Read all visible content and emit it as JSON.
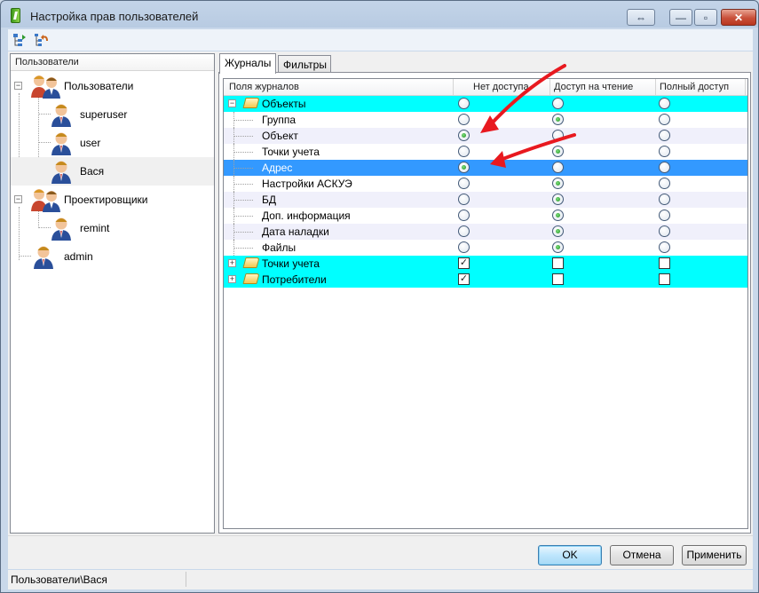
{
  "window": {
    "title": "Настройка прав пользователей",
    "buttons": [
      {
        "name": "restore",
        "glyph": "⇔"
      },
      {
        "name": "minimize",
        "glyph": "—"
      },
      {
        "name": "maximize",
        "glyph": "▫"
      },
      {
        "name": "close",
        "glyph": "✕"
      }
    ]
  },
  "toolbar": {
    "icons": [
      "apply-tree-icon",
      "undo-tree-icon"
    ]
  },
  "left_panel": {
    "header": "Пользователи",
    "tree": [
      {
        "label": "Пользователи",
        "type": "group",
        "expanded": true,
        "expander": "−"
      },
      {
        "label": "superuser",
        "type": "user"
      },
      {
        "label": "user",
        "type": "user"
      },
      {
        "label": "Вася",
        "type": "user",
        "selected": true
      },
      {
        "label": "Проектировщики",
        "type": "group",
        "expanded": true,
        "expander": "−"
      },
      {
        "label": "remint",
        "type": "user"
      },
      {
        "label": "admin",
        "type": "user"
      }
    ]
  },
  "tabs": [
    {
      "label": "Журналы",
      "active": true
    },
    {
      "label": "Фильтры",
      "active": false
    }
  ],
  "grid": {
    "columns": [
      "Поля журналов",
      "Нет доступа",
      "Доступ на чтение",
      "Полный доступ"
    ],
    "rows": [
      {
        "label": "Объекты",
        "level": 0,
        "kind": "folder",
        "expander": "−",
        "style": "cyan",
        "controls": "radio",
        "values": [
          false,
          false,
          false
        ]
      },
      {
        "label": "Группа",
        "level": 1,
        "style": "white",
        "controls": "radio",
        "values": [
          false,
          true,
          false
        ]
      },
      {
        "label": "Объект",
        "level": 1,
        "style": "alt",
        "controls": "radio",
        "values": [
          true,
          false,
          false
        ]
      },
      {
        "label": "Точки учета",
        "level": 1,
        "style": "white",
        "controls": "radio",
        "values": [
          false,
          true,
          false
        ]
      },
      {
        "label": "Адрес",
        "level": 1,
        "style": "sel",
        "controls": "radio",
        "values": [
          true,
          false,
          false
        ]
      },
      {
        "label": "Настройки АСКУЭ",
        "level": 1,
        "style": "white",
        "controls": "radio",
        "values": [
          false,
          true,
          false
        ]
      },
      {
        "label": "БД",
        "level": 1,
        "style": "alt",
        "controls": "radio",
        "values": [
          false,
          true,
          false
        ]
      },
      {
        "label": "Доп. информация",
        "level": 1,
        "style": "white",
        "controls": "radio",
        "values": [
          false,
          true,
          false
        ]
      },
      {
        "label": "Дата наладки",
        "level": 1,
        "style": "alt",
        "controls": "radio",
        "values": [
          false,
          true,
          false
        ]
      },
      {
        "label": "Файлы",
        "level": 1,
        "style": "white",
        "controls": "radio",
        "values": [
          false,
          true,
          false
        ]
      },
      {
        "label": "Точки учета",
        "level": 0,
        "kind": "folder",
        "expander": "+",
        "style": "cyan",
        "controls": "checkbox",
        "values": [
          true,
          false,
          false
        ]
      },
      {
        "label": "Потребители",
        "level": 0,
        "kind": "folder",
        "expander": "+",
        "style": "cyan",
        "controls": "checkbox",
        "values": [
          true,
          false,
          false
        ]
      }
    ]
  },
  "buttons": {
    "ok": "OK",
    "cancel": "Отмена",
    "apply": "Применить"
  },
  "status": {
    "path": "Пользователи\\Вася"
  },
  "colors": {
    "group_row": "#00ffff",
    "selected_row": "#3399ff",
    "annotation_arrow": "#e8191f"
  }
}
